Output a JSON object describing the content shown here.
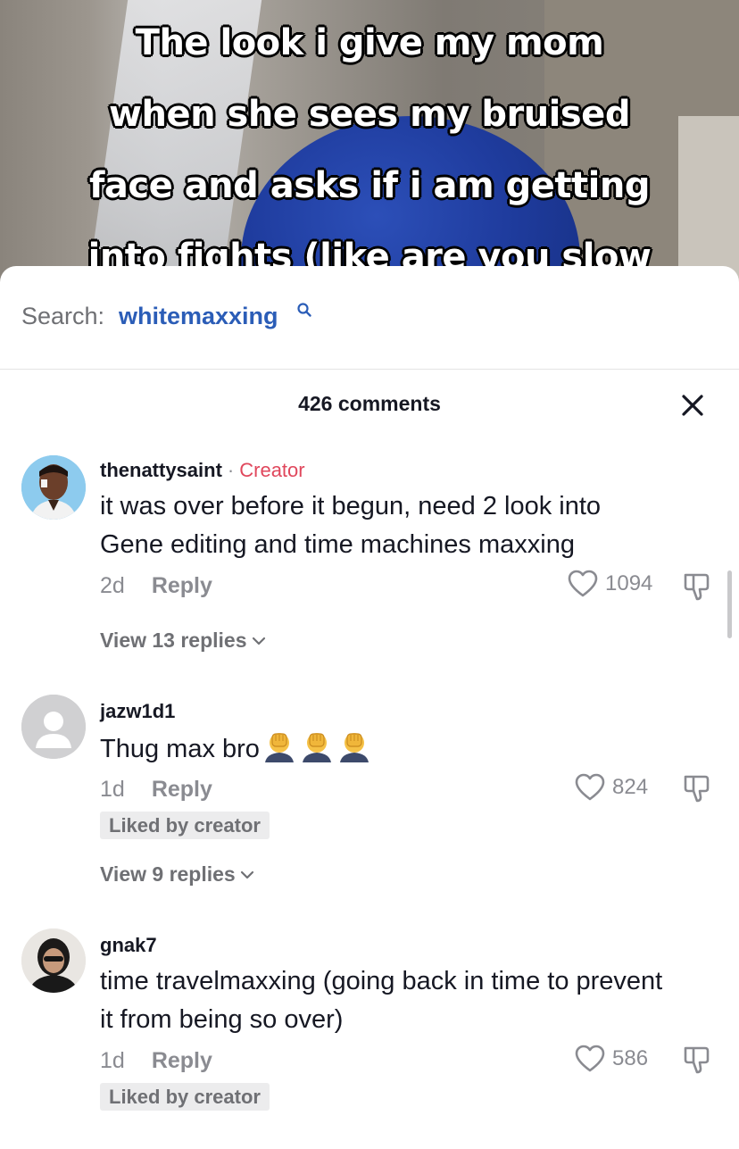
{
  "video": {
    "caption_lines": [
      "The look i give my mom",
      "when she sees my bruised",
      "face and asks if i am getting",
      "into fights (like are you slow"
    ]
  },
  "search": {
    "prefix": "Search:",
    "term": "whitemaxxing",
    "icon": "search-icon"
  },
  "header": {
    "comments_count": "426 comments",
    "close_icon": "close-icon"
  },
  "comments": [
    {
      "username": "thenattysaint",
      "separator": "·",
      "creator_label": "Creator",
      "text_lines": [
        "it was over before it begun, need 2 look into",
        "Gene editing and time machines maxxing"
      ],
      "age": "2d",
      "reply_label": "Reply",
      "likes": "1094",
      "view_replies": "View 13 replies"
    },
    {
      "username": "jazw1d1",
      "text": "Thug max bro",
      "emoji": "facepalm-emoji",
      "emoji_count": 3,
      "age": "1d",
      "reply_label": "Reply",
      "likes": "824",
      "liked_by_creator": "Liked by creator",
      "view_replies": "View 9 replies"
    },
    {
      "username": "gnak7",
      "text_lines": [
        "time travelmaxxing (going back in time to prevent",
        "it from being so over)"
      ],
      "age": "1d",
      "reply_label": "Reply",
      "likes": "586",
      "liked_by_creator": "Liked by creator"
    }
  ],
  "colors": {
    "accent_blue": "#2b5db7",
    "creator_red": "#e0475c",
    "muted_gray": "#8a8b91",
    "text": "#161823"
  }
}
